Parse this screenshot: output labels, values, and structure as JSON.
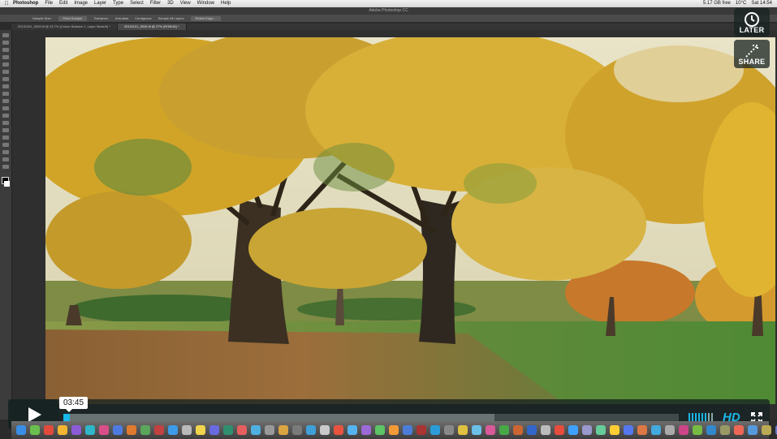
{
  "menubar": {
    "app_name": "Photoshop",
    "items": [
      "File",
      "Edit",
      "Image",
      "Layer",
      "Type",
      "Select",
      "Filter",
      "3D",
      "View",
      "Window",
      "Help"
    ],
    "status_right": [
      "5.17 GB free",
      "10°C",
      "Sat 14:54"
    ]
  },
  "ps": {
    "window_title": "Adobe Photoshop CC",
    "options": [
      "Sample Size:",
      "Point Sample",
      "Tolerance:",
      "Anti-alias",
      "Contiguous",
      "Sample All Layers",
      "Refine Edge..."
    ],
    "tabs": [
      "20131101_0026.tif @ 33.7% (Colour Balance 1, Layer Mask/8) *",
      "20131101_0026.tif @ 27% (RGB/16) *"
    ]
  },
  "overlay": {
    "later_label": "LATER",
    "share_label": "SHARE",
    "later_icon": "clock-icon",
    "share_icon": "share-icon"
  },
  "player": {
    "current_time": "03:45",
    "progress_played_fraction": 0.01,
    "progress_loaded_fraction": 0.7,
    "volume_level": 0.75,
    "hd_label": "HD",
    "colors": {
      "accent": "#1ab7ea",
      "panel": "#172322"
    }
  },
  "dock": {
    "app_colors": [
      "#3a8ee6",
      "#6bbf4e",
      "#e24b3b",
      "#f2b632",
      "#8c5bd6",
      "#2fb6c9",
      "#d94f8a",
      "#4d7be0",
      "#e07a2f",
      "#5aa65a",
      "#c24141",
      "#3d9be9",
      "#b9b9b9",
      "#f0d44c",
      "#6a6ae0",
      "#2f8f6f",
      "#e65f5f",
      "#4fb0e0",
      "#999999",
      "#d9a441",
      "#7a7a7a",
      "#3fa0d8",
      "#c9c9c9",
      "#e8533f",
      "#55b3f0",
      "#9c6ad6",
      "#5dc466",
      "#f29a38",
      "#4b7dd8",
      "#aa3333",
      "#2b9cd8",
      "#888888",
      "#e0c040",
      "#6cc0e6",
      "#d85a9a",
      "#48a848",
      "#cc6633",
      "#3366cc",
      "#bbbbbb",
      "#e84c3d",
      "#40a0ff",
      "#9999cc",
      "#66cc99",
      "#ffcc33",
      "#5577ee",
      "#dd7744",
      "#44aadd",
      "#aaaaaa",
      "#cc4488",
      "#77bb44",
      "#3388cc",
      "#999966",
      "#ee6655",
      "#5599dd",
      "#bbaa55",
      "#6677cc",
      "#dd5566",
      "#4499aa",
      "#cccccc",
      "#7766aa",
      "#55bb88"
    ]
  }
}
